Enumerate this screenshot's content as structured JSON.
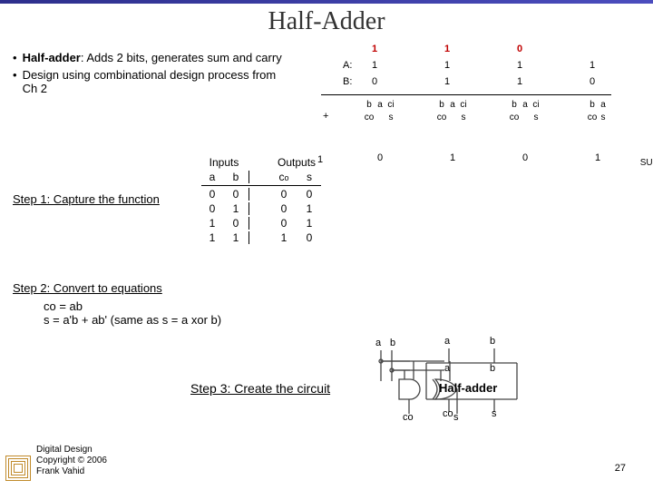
{
  "title": "Half-Adder",
  "bullets": [
    {
      "lead": "Half-adder",
      "rest": ": Adds 2 bits, generates sum and carry"
    },
    {
      "lead": "",
      "rest": "Design using combinational design process from Ch 2"
    }
  ],
  "truth_table": {
    "header_in": "Inputs",
    "header_out": "Outputs",
    "cols": {
      "a": "a",
      "b": "b",
      "co": "co",
      "s": "s"
    },
    "rows": [
      {
        "a": "0",
        "b": "0",
        "co": "0",
        "s": "0"
      },
      {
        "a": "0",
        "b": "1",
        "co": "0",
        "s": "1"
      },
      {
        "a": "1",
        "b": "0",
        "co": "0",
        "s": "1"
      },
      {
        "a": "1",
        "b": "1",
        "co": "1",
        "s": "0"
      }
    ]
  },
  "steps": {
    "s1": "Step 1: Capture the function",
    "s2": "Step 2: Convert to equations",
    "s3": "Step 3: Create the circuit"
  },
  "equations": {
    "co": "co = ab",
    "s": "s = a'b + ab'  (same as s = a xor b)"
  },
  "addition": {
    "row_a_label": "A:",
    "row_b_label": "B:",
    "plus": "+",
    "carries": [
      "1",
      "1",
      "0"
    ],
    "a_bits": [
      "1",
      "1",
      "1",
      "1"
    ],
    "b_bits": [
      "0",
      "1",
      "1",
      "0"
    ],
    "sum_bits": [
      "1",
      "0",
      "1",
      "0",
      "1"
    ],
    "sum_label": "SUM",
    "full_col_in": [
      "b",
      "a",
      "ci"
    ],
    "full_col_out": [
      "co",
      "s"
    ],
    "half_col_in": [
      "b",
      "a"
    ],
    "half_col_out": [
      "co",
      "s"
    ]
  },
  "half_adder": {
    "name": "Half-adder",
    "in_a": "a",
    "in_b": "b",
    "out_co": "co",
    "out_s": "s",
    "inner_a": "a",
    "inner_b": "b"
  },
  "credit": {
    "l1": "Digital Design",
    "l2": "Copyright © 2006",
    "l3": "Frank Vahid"
  },
  "page": "27"
}
